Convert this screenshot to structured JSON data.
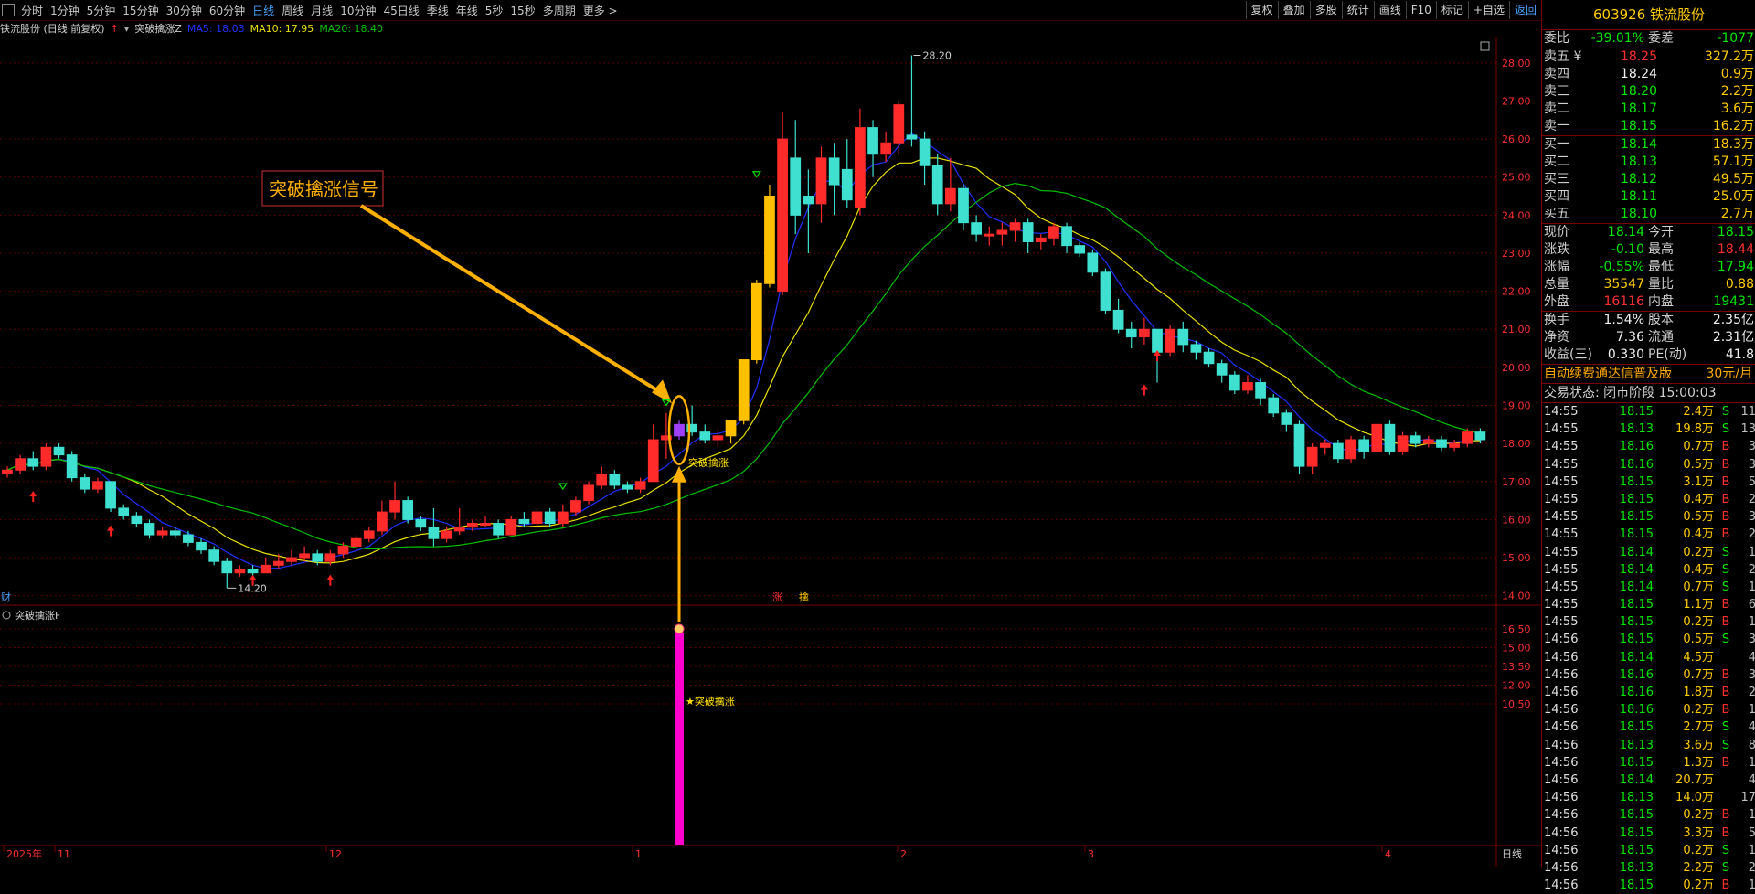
{
  "toolbar": {
    "timeframes": [
      "分时",
      "1分钟",
      "5分钟",
      "15分钟",
      "30分钟",
      "60分钟",
      "日线",
      "周线",
      "月线",
      "10分钟",
      "45日线",
      "季线",
      "年线",
      "5秒",
      "15秒",
      "多周期",
      "更多 >"
    ],
    "active_index": 6,
    "right_buttons": [
      "复权",
      "叠加",
      "多股",
      "统计",
      "画线",
      "F10",
      "标记",
      "+自选",
      "返回"
    ]
  },
  "info": {
    "stock_label": "铁流股份 (日线 前复权)",
    "indicator_name": "突破擒涨Z",
    "ma5": "MA5: 18.03",
    "ma10": "MA10: 17.95",
    "ma20": "MA20: 18.40"
  },
  "chart": {
    "annotation_box": "突破擒涨信号",
    "signal_label": "突破擒涨",
    "high_label": "28.20",
    "low_label": "14.20",
    "zhang_mark": "涨",
    "qin_mark": "擒",
    "cai_mark": "财",
    "sub_title": "突破擒涨F",
    "sub_label": "突破擒涨",
    "x_axis_labels": [
      "2025年",
      "11",
      "12",
      "1",
      "2",
      "3",
      "4"
    ],
    "x_axis_corner": "日线",
    "price_ticks": [
      "28.00",
      "27.00",
      "26.00",
      "25.00",
      "24.00",
      "23.00",
      "22.00",
      "21.00",
      "20.00",
      "19.00",
      "18.00",
      "17.00",
      "16.00",
      "15.00",
      "14.00"
    ],
    "sub_ticks": [
      "16.50",
      "15.00",
      "13.50",
      "12.00",
      "10.50"
    ]
  },
  "chart_data": {
    "type": "candlestick",
    "ylim": [
      13.8,
      28.5
    ],
    "candles": [
      [
        17.2,
        17.3,
        17.1,
        17.4
      ],
      [
        17.3,
        17.6,
        17.2,
        17.7
      ],
      [
        17.6,
        17.4,
        17.3,
        17.8
      ],
      [
        17.4,
        17.9,
        17.3,
        18.0
      ],
      [
        17.9,
        17.7,
        17.6,
        18.0
      ],
      [
        17.7,
        17.1,
        17.0,
        17.8
      ],
      [
        17.1,
        16.8,
        16.7,
        17.2
      ],
      [
        16.8,
        17.0,
        16.7,
        17.1
      ],
      [
        17.0,
        16.3,
        16.2,
        17.0
      ],
      [
        16.3,
        16.1,
        16.0,
        16.4
      ],
      [
        16.1,
        15.9,
        15.8,
        16.2
      ],
      [
        15.9,
        15.6,
        15.5,
        16.0
      ],
      [
        15.6,
        15.7,
        15.5,
        15.8
      ],
      [
        15.7,
        15.6,
        15.5,
        15.8
      ],
      [
        15.6,
        15.4,
        15.3,
        15.7
      ],
      [
        15.4,
        15.2,
        15.1,
        15.5
      ],
      [
        15.2,
        14.9,
        14.8,
        15.3
      ],
      [
        14.9,
        14.6,
        14.2,
        15.0
      ],
      [
        14.6,
        14.7,
        14.5,
        14.8
      ],
      [
        14.7,
        14.6,
        14.5,
        14.8
      ],
      [
        14.6,
        14.8,
        14.6,
        15.0
      ],
      [
        14.8,
        14.9,
        14.7,
        15.1
      ],
      [
        14.9,
        15.0,
        14.8,
        15.2
      ],
      [
        15.0,
        15.1,
        14.9,
        15.3
      ],
      [
        15.1,
        14.9,
        14.8,
        15.2
      ],
      [
        14.9,
        15.1,
        14.8,
        15.2
      ],
      [
        15.1,
        15.3,
        15.0,
        15.4
      ],
      [
        15.3,
        15.5,
        15.2,
        15.6
      ],
      [
        15.5,
        15.7,
        15.4,
        15.8
      ],
      [
        15.7,
        16.2,
        15.6,
        16.5
      ],
      [
        16.2,
        16.5,
        16.0,
        17.0
      ],
      [
        16.5,
        16.0,
        15.9,
        16.6
      ],
      [
        16.0,
        15.8,
        15.7,
        16.1
      ],
      [
        15.8,
        15.5,
        15.3,
        16.3
      ],
      [
        15.5,
        15.7,
        15.4,
        15.8
      ],
      [
        15.7,
        15.8,
        15.6,
        16.3
      ],
      [
        15.8,
        15.9,
        15.7,
        16.0
      ],
      [
        15.9,
        15.9,
        15.8,
        16.1
      ],
      [
        15.9,
        15.6,
        15.5,
        16.0
      ],
      [
        15.6,
        16.0,
        15.6,
        16.1
      ],
      [
        16.0,
        15.9,
        15.8,
        16.2
      ],
      [
        15.9,
        16.2,
        15.8,
        16.3
      ],
      [
        16.2,
        15.9,
        15.8,
        16.3
      ],
      [
        15.9,
        16.2,
        15.8,
        16.4
      ],
      [
        16.2,
        16.5,
        16.1,
        16.6
      ],
      [
        16.5,
        16.9,
        16.4,
        17.0
      ],
      [
        16.9,
        17.2,
        16.8,
        17.4
      ],
      [
        17.2,
        16.9,
        16.8,
        17.3
      ],
      [
        16.9,
        16.8,
        16.7,
        17.0
      ],
      [
        16.8,
        17.0,
        16.7,
        17.1
      ],
      [
        17.0,
        18.1,
        17.0,
        18.5
      ],
      [
        18.1,
        18.2,
        17.6,
        18.8
      ],
      [
        18.2,
        18.5,
        18.1,
        18.6
      ],
      [
        18.5,
        18.3,
        18.2,
        19.0
      ],
      [
        18.3,
        18.1,
        18.0,
        18.5
      ],
      [
        18.1,
        18.2,
        17.9,
        18.4
      ],
      [
        18.2,
        18.6,
        18.0,
        18.6
      ],
      [
        18.6,
        20.2,
        18.5,
        20.2
      ],
      [
        20.2,
        22.2,
        20.1,
        22.3
      ],
      [
        22.2,
        24.5,
        22.1,
        24.8
      ],
      [
        22.0,
        26.0,
        21.9,
        26.7
      ],
      [
        25.5,
        24.0,
        23.5,
        26.5
      ],
      [
        24.5,
        24.3,
        23.0,
        25.2
      ],
      [
        24.3,
        25.5,
        23.8,
        25.8
      ],
      [
        25.5,
        24.8,
        24.0,
        25.9
      ],
      [
        25.2,
        24.4,
        24.2,
        26.0
      ],
      [
        24.2,
        26.3,
        24.0,
        26.8
      ],
      [
        26.3,
        25.6,
        25.0,
        26.5
      ],
      [
        25.6,
        25.9,
        25.4,
        26.2
      ],
      [
        25.9,
        26.9,
        25.6,
        27.0
      ],
      [
        26.1,
        26.0,
        25.8,
        28.2
      ],
      [
        26.0,
        25.3,
        24.8,
        26.2
      ],
      [
        25.3,
        24.3,
        24.0,
        25.6
      ],
      [
        24.3,
        24.7,
        24.1,
        25.5
      ],
      [
        24.7,
        23.8,
        23.6,
        24.8
      ],
      [
        23.8,
        23.5,
        23.3,
        24.0
      ],
      [
        23.5,
        23.5,
        23.2,
        23.7
      ],
      [
        23.5,
        23.6,
        23.2,
        23.8
      ],
      [
        23.6,
        23.8,
        23.3,
        23.9
      ],
      [
        23.8,
        23.3,
        23.0,
        23.9
      ],
      [
        23.3,
        23.4,
        23.1,
        23.5
      ],
      [
        23.4,
        23.7,
        23.2,
        23.8
      ],
      [
        23.7,
        23.2,
        23.0,
        23.8
      ],
      [
        23.2,
        23.0,
        22.9,
        23.3
      ],
      [
        23.0,
        22.5,
        22.4,
        23.1
      ],
      [
        22.5,
        21.5,
        21.4,
        22.6
      ],
      [
        21.5,
        21.0,
        20.9,
        21.8
      ],
      [
        21.0,
        20.8,
        20.5,
        21.2
      ],
      [
        20.8,
        21.0,
        20.6,
        21.3
      ],
      [
        21.0,
        20.4,
        19.6,
        21.0
      ],
      [
        20.4,
        21.0,
        20.3,
        21.1
      ],
      [
        21.0,
        20.6,
        20.4,
        21.2
      ],
      [
        20.6,
        20.4,
        20.2,
        20.7
      ],
      [
        20.4,
        20.1,
        20.0,
        20.5
      ],
      [
        20.1,
        19.8,
        19.6,
        20.2
      ],
      [
        19.8,
        19.4,
        19.3,
        19.9
      ],
      [
        19.4,
        19.6,
        19.3,
        19.8
      ],
      [
        19.6,
        19.2,
        19.0,
        19.7
      ],
      [
        19.2,
        18.8,
        18.7,
        19.3
      ],
      [
        18.8,
        18.5,
        18.3,
        18.9
      ],
      [
        18.5,
        17.4,
        17.2,
        18.6
      ],
      [
        17.4,
        17.9,
        17.2,
        18.0
      ],
      [
        17.9,
        18.0,
        17.7,
        18.1
      ],
      [
        18.0,
        17.6,
        17.5,
        18.1
      ],
      [
        17.6,
        18.1,
        17.5,
        18.2
      ],
      [
        18.1,
        17.8,
        17.6,
        18.2
      ],
      [
        17.8,
        18.5,
        17.8,
        18.5
      ],
      [
        18.5,
        17.8,
        17.7,
        18.6
      ],
      [
        17.8,
        18.2,
        17.7,
        18.3
      ],
      [
        18.2,
        18.0,
        17.9,
        18.3
      ],
      [
        18.0,
        18.1,
        17.9,
        18.2
      ],
      [
        18.1,
        17.9,
        17.8,
        18.2
      ],
      [
        17.9,
        18.0,
        17.8,
        18.1
      ],
      [
        18.0,
        18.3,
        17.9,
        18.4
      ],
      [
        18.3,
        18.1,
        18.0,
        18.4
      ]
    ],
    "yellow_candles": [
      56,
      57,
      58,
      59
    ],
    "purple_candle": 52
  },
  "quote": {
    "title": "603926 铁流股份",
    "weibi": {
      "label": "委比",
      "value": "-39.01%",
      "label2": "委差",
      "value2": "-1077"
    },
    "asks": [
      {
        "label": "卖五 ¥",
        "price": "18.25",
        "vol": "327.2万",
        "color": "red"
      },
      {
        "label": "卖四",
        "price": "18.24",
        "vol": "0.9万",
        "color": "white"
      },
      {
        "label": "卖三",
        "price": "18.20",
        "vol": "2.2万",
        "color": "green"
      },
      {
        "label": "卖二",
        "price": "18.17",
        "vol": "3.6万",
        "color": "green"
      },
      {
        "label": "卖一",
        "price": "18.15",
        "vol": "16.2万",
        "color": "green"
      }
    ],
    "bids": [
      {
        "label": "买一",
        "price": "18.14",
        "vol": "18.3万",
        "color": "green"
      },
      {
        "label": "买二",
        "price": "18.13",
        "vol": "57.1万",
        "color": "green"
      },
      {
        "label": "买三",
        "price": "18.12",
        "vol": "49.5万",
        "color": "green"
      },
      {
        "label": "买四",
        "price": "18.11",
        "vol": "25.0万",
        "color": "green"
      },
      {
        "label": "买五",
        "price": "18.10",
        "vol": "2.7万",
        "color": "green"
      }
    ],
    "stats": [
      {
        "l": "现价",
        "v": "18.14",
        "vc": "green",
        "l2": "今开",
        "v2": "18.15",
        "v2c": "green"
      },
      {
        "l": "涨跌",
        "v": "-0.10",
        "vc": "green",
        "l2": "最高",
        "v2": "18.44",
        "v2c": "red"
      },
      {
        "l": "涨幅",
        "v": "-0.55%",
        "vc": "green",
        "l2": "最低",
        "v2": "17.94",
        "v2c": "green"
      },
      {
        "l": "总量",
        "v": "35547",
        "vc": "yellow",
        "l2": "量比",
        "v2": "0.88",
        "v2c": "yellow"
      },
      {
        "l": "外盘",
        "v": "16116",
        "vc": "red",
        "l2": "内盘",
        "v2": "19431",
        "v2c": "green"
      }
    ],
    "stats2": [
      {
        "l": "换手",
        "v": "1.54%",
        "vc": "white",
        "l2": "股本",
        "v2": "2.35亿",
        "v2c": "white"
      },
      {
        "l": "净资",
        "v": "7.36",
        "vc": "white",
        "l2": "流通",
        "v2": "2.31亿",
        "v2c": "white"
      },
      {
        "l": "收益(三)",
        "v": "0.330",
        "vc": "white",
        "l2": "PE(动)",
        "v2": "41.8",
        "v2c": "white"
      }
    ],
    "ad": "自动续费通达信普及版",
    "ad_price": "30元/月",
    "status": "交易状态: 闭市阶段 15:00:03",
    "ticks": [
      [
        "14:55",
        "18.15",
        "2.4万",
        "S",
        "11",
        "green"
      ],
      [
        "14:55",
        "18.13",
        "19.8万",
        "S",
        "13",
        "green"
      ],
      [
        "14:55",
        "18.16",
        "0.7万",
        "B",
        "3",
        "green"
      ],
      [
        "14:55",
        "18.16",
        "0.5万",
        "B",
        "3",
        "green"
      ],
      [
        "14:55",
        "18.15",
        "3.1万",
        "B",
        "5",
        "green"
      ],
      [
        "14:55",
        "18.15",
        "0.4万",
        "B",
        "2",
        "green"
      ],
      [
        "14:55",
        "18.15",
        "0.5万",
        "B",
        "3",
        "green"
      ],
      [
        "14:55",
        "18.15",
        "0.4万",
        "B",
        "2",
        "green"
      ],
      [
        "14:55",
        "18.14",
        "0.2万",
        "S",
        "1",
        "green"
      ],
      [
        "14:55",
        "18.14",
        "0.4万",
        "S",
        "2",
        "green"
      ],
      [
        "14:55",
        "18.14",
        "0.7万",
        "S",
        "1",
        "green"
      ],
      [
        "14:55",
        "18.15",
        "1.1万",
        "B",
        "6",
        "green"
      ],
      [
        "14:55",
        "18.15",
        "0.2万",
        "B",
        "1",
        "green"
      ],
      [
        "14:56",
        "18.15",
        "0.5万",
        "S",
        "3",
        "green"
      ],
      [
        "14:56",
        "18.14",
        "4.5万",
        "",
        "4",
        "green"
      ],
      [
        "14:56",
        "18.16",
        "0.7万",
        "B",
        "3",
        "green"
      ],
      [
        "14:56",
        "18.16",
        "1.8万",
        "B",
        "2",
        "green"
      ],
      [
        "14:56",
        "18.16",
        "0.2万",
        "B",
        "1",
        "green"
      ],
      [
        "14:56",
        "18.15",
        "2.7万",
        "S",
        "4",
        "green"
      ],
      [
        "14:56",
        "18.13",
        "3.6万",
        "S",
        "8",
        "green"
      ],
      [
        "14:56",
        "18.15",
        "1.3万",
        "B",
        "1",
        "green"
      ],
      [
        "14:56",
        "18.14",
        "20.7万",
        "",
        "4",
        "green"
      ],
      [
        "14:56",
        "18.13",
        "14.0万",
        "",
        "17",
        "green"
      ],
      [
        "14:56",
        "18.15",
        "0.2万",
        "B",
        "1",
        "green"
      ],
      [
        "14:56",
        "18.15",
        "3.3万",
        "B",
        "5",
        "green"
      ],
      [
        "14:56",
        "18.15",
        "0.2万",
        "S",
        "1",
        "green"
      ],
      [
        "14:56",
        "18.13",
        "2.2万",
        "S",
        "2",
        "green"
      ],
      [
        "14:56",
        "18.15",
        "0.2万",
        "B",
        "1",
        "green"
      ]
    ]
  },
  "colors": {
    "up": "#ff2a2a",
    "down": "#3fe0d0",
    "ma5": "#2030ff",
    "ma10": "#e8e000",
    "ma20": "#00c000",
    "accent": "#ffb000",
    "grid": "#5a0000"
  }
}
